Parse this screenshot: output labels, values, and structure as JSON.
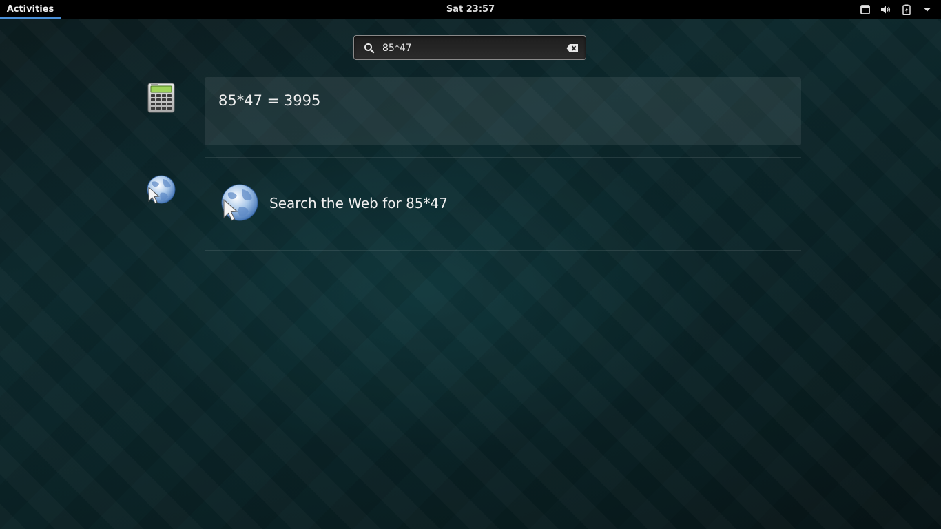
{
  "topbar": {
    "activities_label": "Activities",
    "clock": "Sat 23:57",
    "tray_icons": [
      "window-icon",
      "volume-icon",
      "battery-icon",
      "menu-arrow-icon"
    ]
  },
  "search": {
    "query": "85*47",
    "icon": "search-icon",
    "clear_icon": "clear-icon"
  },
  "results": {
    "calculator": {
      "icon": "calculator-icon",
      "text": "85*47 = 3995"
    },
    "web": {
      "icon": "web-globe-icon",
      "text": "Search the Web for 85*47"
    }
  },
  "colors": {
    "topbar_bg": "#000000",
    "accent": "#4a90d9",
    "text": "#eeeeee"
  }
}
